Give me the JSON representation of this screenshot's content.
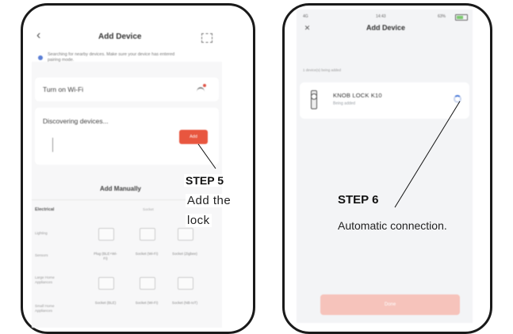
{
  "left_screen": {
    "title": "Add Device",
    "hint_text": "Searching for nearby devices. Make sure your device has entered pairing mode.",
    "wifi_label": "Turn on Wi-Fi",
    "discovering_label": "Discovering devices...",
    "add_button_label": "Add",
    "add_manually_title": "Add Manually",
    "category_label": "Electrical",
    "category_sub": "Socket",
    "rows": [
      {
        "label": "Lighting",
        "items": [
          "",
          "",
          ""
        ]
      },
      {
        "label": "Sensors",
        "items": [
          "Plug (BLE+Wi-Fi)",
          "Socket (Wi-Fi)",
          "Socket (Zigbee)"
        ]
      },
      {
        "label": "Large Home Appliances",
        "items": [
          "",
          "",
          ""
        ]
      },
      {
        "label": "Small Home Appliances",
        "items": [
          "Socket (BLE)",
          "Socket (Wi-Fi)",
          "Socket (NB-IoT)"
        ]
      }
    ]
  },
  "right_screen": {
    "status_carrier": "4G",
    "status_time": "14:43",
    "status_battery": "63%",
    "title": "Add Device",
    "close_label": "×",
    "sub_hint": "1 device(s) being added",
    "device_name": "KNOB LOCK  K10",
    "device_status": "Being added",
    "done_button": "Done"
  },
  "steps": {
    "step5": {
      "heading": "STEP 5",
      "line1": "Add the",
      "line2": "lock"
    },
    "step6": {
      "heading": "STEP 6",
      "text": "Automatic connection."
    }
  },
  "colors": {
    "accent_orange": "#e8563f",
    "accent_blue": "#4a79d8",
    "frame": "#1a1a1a"
  }
}
